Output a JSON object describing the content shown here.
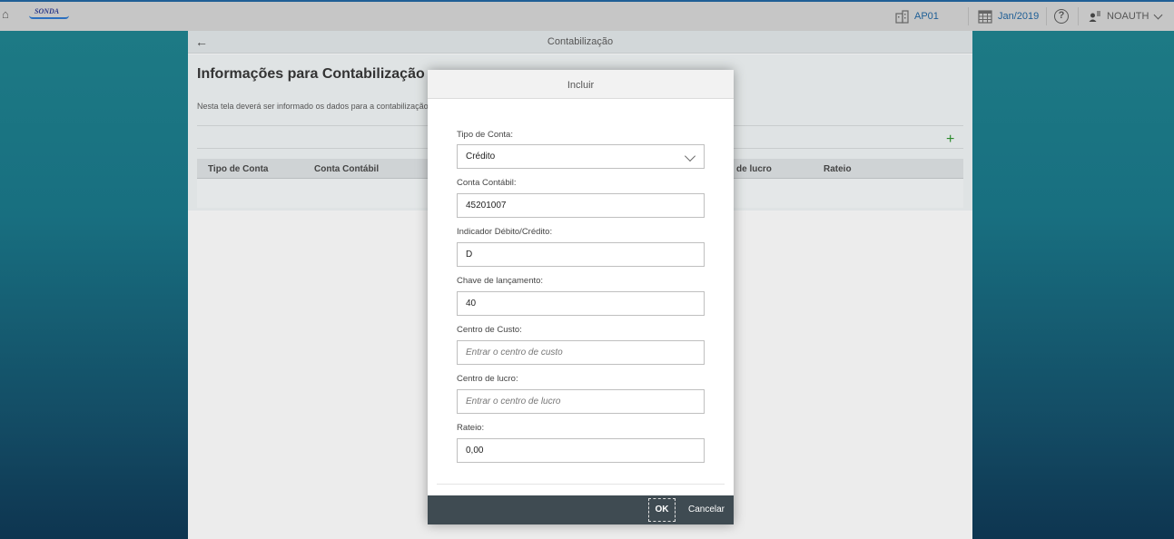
{
  "shell": {
    "company_label": "AP01",
    "period_label": "Jan/2019",
    "help_symbol": "?",
    "user_label": "NOAUTH",
    "logo_text": "SONDA",
    "accent_color": "#1f5f96"
  },
  "page": {
    "title": "Contabilização",
    "object_title": "Informações para Contabilização",
    "object_description": "Nesta tela deverá ser informado os dados para a contabilização",
    "table": {
      "columns": [
        "Tipo de Conta",
        "Conta Contábil",
        "Centro de lucro",
        "Rateio"
      ],
      "visible_partial_column": "de lucro"
    }
  },
  "dialog": {
    "title": "Incluir",
    "fields": {
      "tipo_conta": {
        "label": "Tipo de Conta:",
        "value": "Crédito"
      },
      "conta_contabil": {
        "label": "Conta Contábil:",
        "value": "45201007"
      },
      "indicador": {
        "label": "Indicador Débito/Crédito:",
        "value": "D"
      },
      "chave": {
        "label": "Chave de lançamento:",
        "value": "40"
      },
      "centro_custo": {
        "label": "Centro de Custo:",
        "value": "",
        "placeholder": "Entrar o centro de custo"
      },
      "centro_lucro": {
        "label": "Centro de lucro:",
        "value": "",
        "placeholder": "Entrar o centro de lucro"
      },
      "rateio": {
        "label": "Rateio:",
        "value": "0,00"
      }
    },
    "buttons": {
      "ok": "OK",
      "cancel": "Cancelar"
    }
  }
}
